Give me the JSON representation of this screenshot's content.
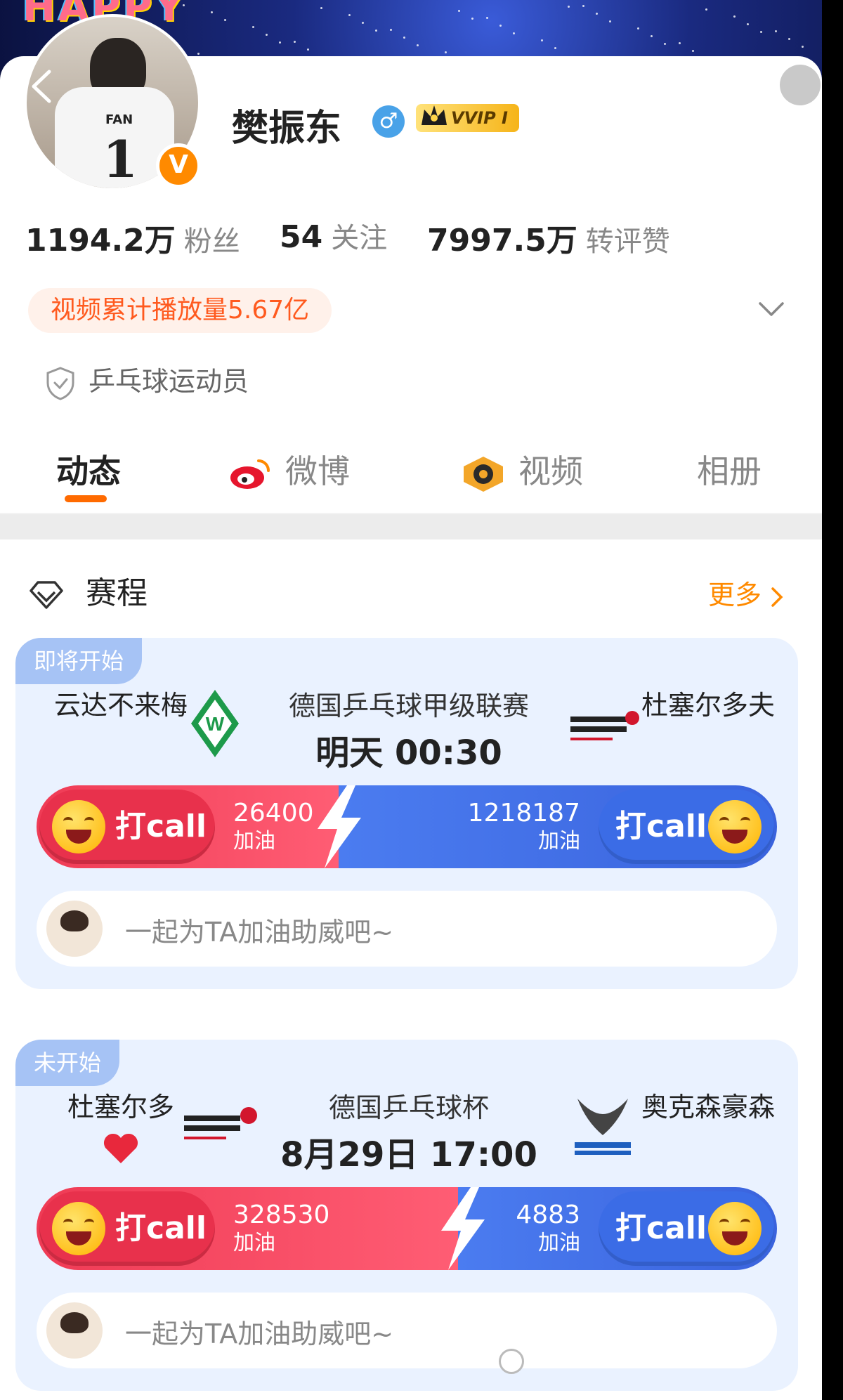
{
  "banner": {
    "text": "HAPPY"
  },
  "profile": {
    "name": "樊振东",
    "gender_symbol": "♂",
    "vip_label": "VVIP I",
    "verified_badge": "V",
    "jersey_name": "FAN",
    "jersey_number": "1"
  },
  "stats": {
    "followers_value": "1194.2万",
    "followers_label": "粉丝",
    "following_value": "54",
    "following_label": "关注",
    "likes_value": "7997.5万",
    "likes_label": "转评赞"
  },
  "highlight_pill": "视频累计播放量5.67亿",
  "certification": "乒乓球运动员",
  "tabs": [
    {
      "label": "动态",
      "active": true
    },
    {
      "label": "微博",
      "active": false
    },
    {
      "label": "视频",
      "active": false
    },
    {
      "label": "相册",
      "active": false
    }
  ],
  "schedule": {
    "title": "赛程",
    "more": "更多",
    "matches": [
      {
        "status": "即将开始",
        "home_team": "云达不来梅",
        "away_team": "杜塞尔多夫",
        "league": "德国乒乓球甲级联赛",
        "time": "明天 00:30",
        "home_button": "打call",
        "away_button": "打call",
        "home_count": "26400",
        "away_count": "1218187",
        "cheer_label": "加油",
        "home_share": 0.3,
        "comment_placeholder": "一起为TA加油助威吧~"
      },
      {
        "status": "未开始",
        "home_team": "杜塞尔多",
        "away_team": "奥克森豪森",
        "league": "德国乒乓球杯",
        "time": "8月29日 17:00",
        "home_button": "打call",
        "away_button": "打call",
        "home_count": "328530",
        "away_count": "4883",
        "cheer_label": "加油",
        "home_share": 0.55,
        "comment_placeholder": "一起为TA加油助威吧~"
      }
    ]
  },
  "colors": {
    "accent": "#ff6a00",
    "red": "#ef3b55",
    "blue": "#3b6ce6",
    "card_bg": "#eaf2ff"
  }
}
